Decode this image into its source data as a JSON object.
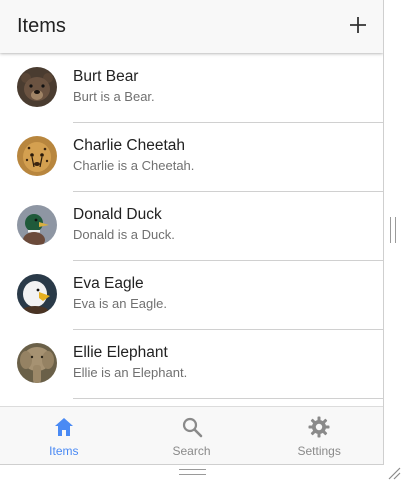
{
  "header": {
    "title": "Items",
    "add_icon": "plus-icon"
  },
  "items": [
    {
      "name": "Burt Bear",
      "desc": "Burt is a Bear."
    },
    {
      "name": "Charlie Cheetah",
      "desc": "Charlie is a Cheetah."
    },
    {
      "name": "Donald Duck",
      "desc": "Donald is a Duck."
    },
    {
      "name": "Eva Eagle",
      "desc": "Eva is an Eagle."
    },
    {
      "name": "Ellie Elephant",
      "desc": "Ellie is an Elephant."
    }
  ],
  "tabs": [
    {
      "label": "Items",
      "icon": "home-icon",
      "active": true
    },
    {
      "label": "Search",
      "icon": "search-icon",
      "active": false
    },
    {
      "label": "Settings",
      "icon": "gear-icon",
      "active": false
    }
  ],
  "colors": {
    "accent": "#4a8af4",
    "inactive": "#8a8a8a"
  }
}
